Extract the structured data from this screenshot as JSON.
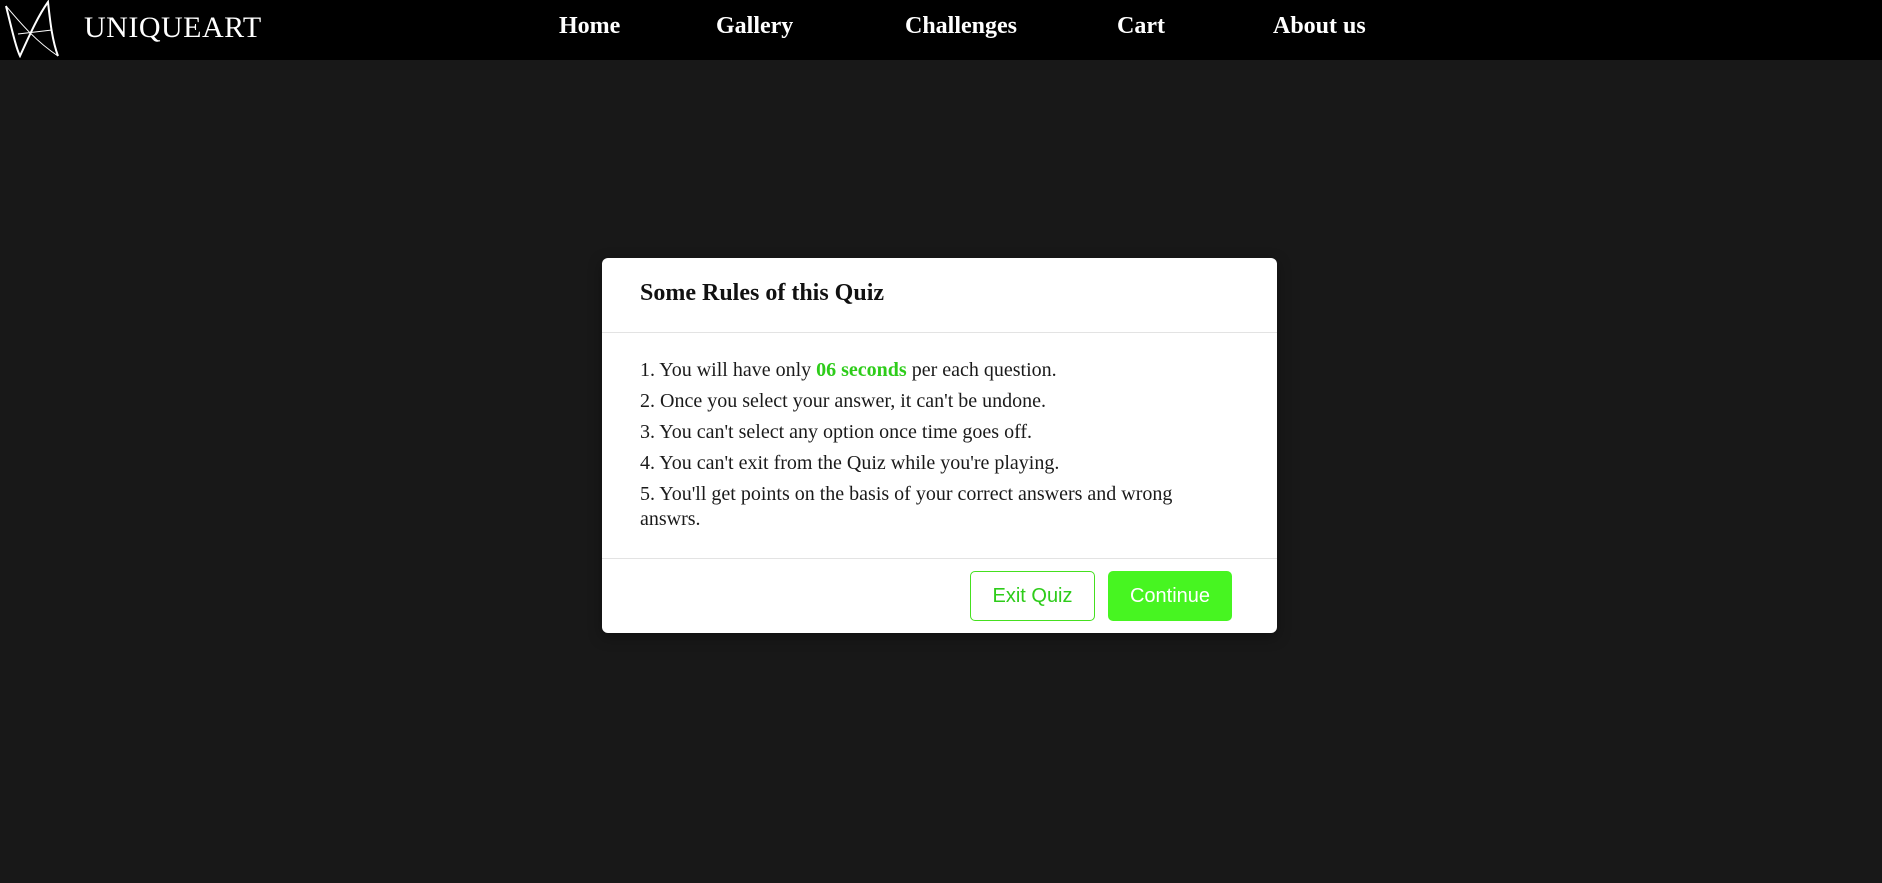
{
  "brand": {
    "name": "UNIQUEART"
  },
  "nav": {
    "home": "Home",
    "gallery": "Gallery",
    "challenges": "Challenges",
    "cart": "Cart",
    "about": "About us"
  },
  "dialog": {
    "title": "Some Rules of this Quiz",
    "rules": {
      "r1_before": "1. You will have only ",
      "r1_highlight": "06 seconds",
      "r1_after": " per each question.",
      "r2": "2. Once you select your answer, it can't be undone.",
      "r3": "3. You can't select any option once time goes off.",
      "r4": "4. You can't exit from the Quiz while you're playing.",
      "r5": "5. You'll get points on the basis of your correct answers and wrong answrs."
    },
    "exit_label": "Exit Quiz",
    "continue_label": "Continue"
  },
  "colors": {
    "accent_green": "#47f521",
    "highlight_green": "#2ecc1a",
    "background": "#181818",
    "navbar": "#000000"
  },
  "icons": {
    "logo": "logo-icon"
  }
}
